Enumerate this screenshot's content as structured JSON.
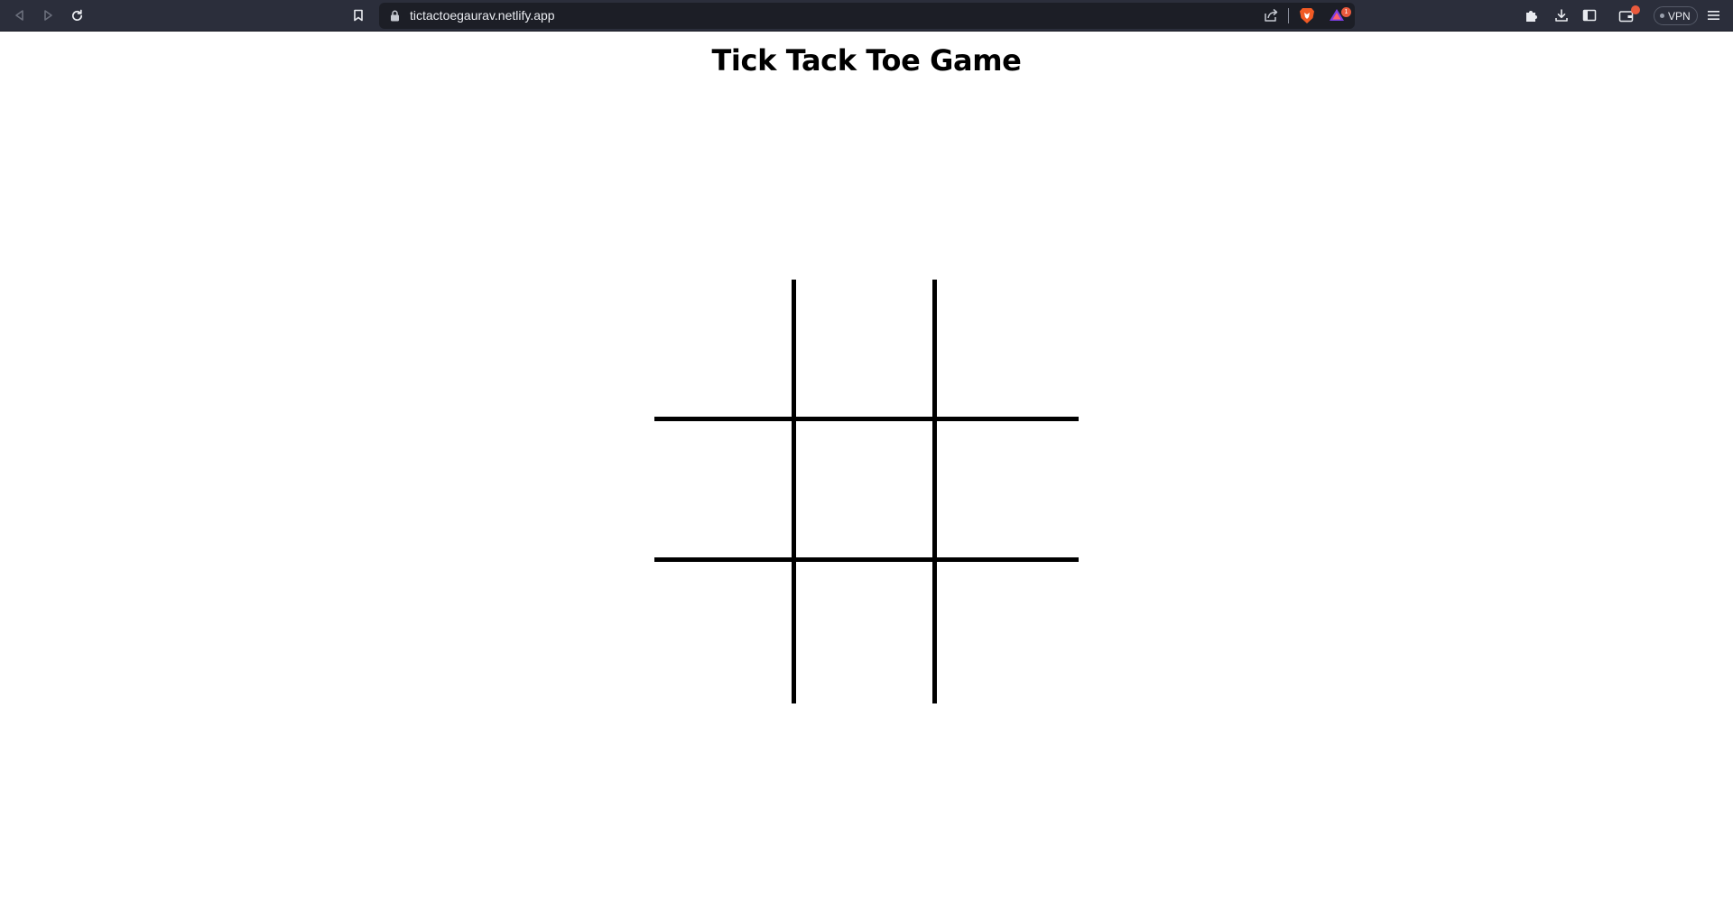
{
  "browser": {
    "url": "tictactoegaurav.netlify.app",
    "rewards_badge_count": "1",
    "vpn_label": "VPN",
    "accent_color": "#ea5a3d",
    "toolbar_color": "#2b2e3b"
  },
  "game": {
    "title": "Tick Tack Toe Game",
    "cells": [
      "",
      "",
      "",
      "",
      "",
      "",
      "",
      "",
      ""
    ]
  }
}
